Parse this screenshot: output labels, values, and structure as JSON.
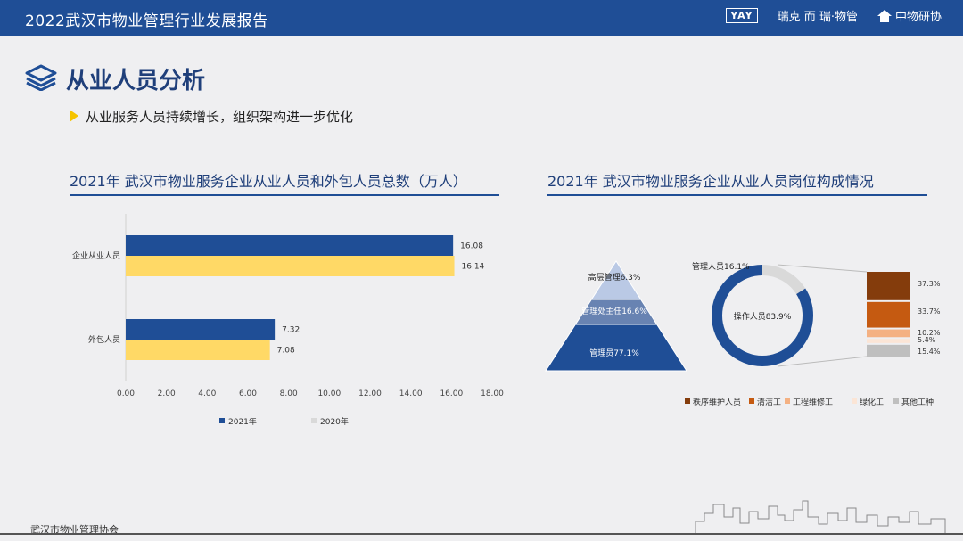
{
  "header": {
    "title": "2022武汉市物业管理行业发展报告",
    "logos": [
      {
        "text": "YAY"
      },
      {
        "text": "瑞克 而 瑞·物管"
      },
      {
        "text": "中物研协"
      }
    ]
  },
  "section": {
    "title": "从业人员分析",
    "bullet": "从业服务人员持续增长，组织架构进一步优化"
  },
  "footer": {
    "text": "武汉市物业管理协会"
  },
  "colors": {
    "blue": "#1f4e96",
    "yellow": "#ffd966",
    "dark_brown": "#843c0c",
    "orange": "#c55a11",
    "peach": "#f4b183",
    "light_peach": "#fbe5d6",
    "gray": "#bfbfbf"
  },
  "chart_data": [
    {
      "type": "bar",
      "orientation": "horizontal",
      "title": "2021年 武汉市物业服务企业从业人员和外包人员总数（万人）",
      "categories": [
        "企业从业人员",
        "外包人员"
      ],
      "series": [
        {
          "name": "2021年",
          "values": [
            16.08,
            7.32
          ],
          "color": "#1f4e96"
        },
        {
          "name": "2020年",
          "values": [
            16.14,
            7.08
          ],
          "color": "#ffd966"
        }
      ],
      "x_ticks": [
        "0.00",
        "2.00",
        "4.00",
        "6.00",
        "8.00",
        "10.00",
        "12.00",
        "14.00",
        "16.00",
        "18.00"
      ],
      "value_labels": [
        [
          "16.08",
          "7.32"
        ],
        [
          "16.14",
          "7.08"
        ]
      ],
      "xlim": [
        0,
        18
      ],
      "legend": "bottom"
    },
    {
      "type": "pyramid",
      "title": "2021年 武汉市物业服务企业从业人员岗位构成情况",
      "layers": [
        {
          "label": "高层管理6.3%",
          "value": 6.3
        },
        {
          "label": "管理处主任16.6%",
          "value": 16.6
        },
        {
          "label": "管理员77.1%",
          "value": 77.1
        }
      ]
    },
    {
      "type": "pie",
      "style": "donut",
      "slices": [
        {
          "label": "操作人员83.9%",
          "value": 83.9,
          "color": "#1f4e96"
        },
        {
          "label": "管理人员16.1%",
          "value": 16.1,
          "color": "#d9d9d9"
        }
      ]
    },
    {
      "type": "bar",
      "style": "stacked-column",
      "categories": [
        "秩序维护人员",
        "清洁工",
        "工程维修工",
        "绿化工",
        "其他工种"
      ],
      "values": [
        37.3,
        33.7,
        10.2,
        5.4,
        15.4
      ],
      "value_labels": [
        "37.3%",
        "33.7%",
        "10.2%",
        "5.4%",
        "15.4%"
      ],
      "colors": [
        "#843c0c",
        "#c55a11",
        "#f4b183",
        "#fbe5d6",
        "#bfbfbf"
      ],
      "legend": "bottom"
    }
  ]
}
